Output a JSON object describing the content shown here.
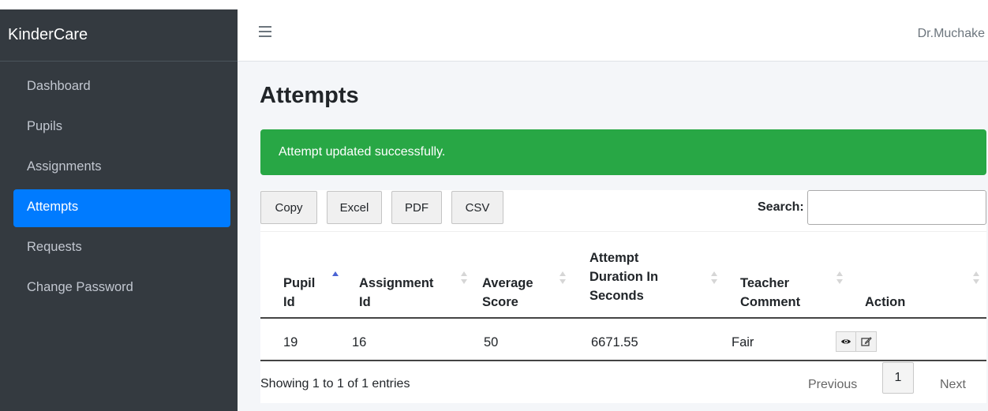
{
  "app": {
    "brand": "KinderCare"
  },
  "sidebar": {
    "items": [
      {
        "label": "Dashboard"
      },
      {
        "label": "Pupils"
      },
      {
        "label": "Assignments"
      },
      {
        "label": "Attempts"
      },
      {
        "label": "Requests"
      },
      {
        "label": "Change Password"
      }
    ],
    "active": "Attempts"
  },
  "header": {
    "user": "Dr.Muchake",
    "menu_icon": "hamburger-menu-icon"
  },
  "page": {
    "title": "Attempts"
  },
  "alert": {
    "message": "Attempt updated successfully.",
    "color": "#28a745"
  },
  "toolbar": {
    "buttons": [
      {
        "label": "Copy"
      },
      {
        "label": "Excel"
      },
      {
        "label": "PDF"
      },
      {
        "label": "CSV"
      }
    ],
    "search_label": "Search:",
    "search_value": ""
  },
  "table": {
    "columns": [
      {
        "line1": "Pupil",
        "line2": "Id"
      },
      {
        "line1": "Assignment",
        "line2": "Id"
      },
      {
        "line1": "Average",
        "line2": "Score"
      },
      {
        "line1": "Attempt",
        "line2": "Duration In",
        "line3": "Seconds"
      },
      {
        "line1": "Teacher",
        "line2": "Comment"
      },
      {
        "line1": "Action"
      }
    ],
    "sorted_column": "Pupil Id",
    "sort_direction": "ascending",
    "rows": [
      {
        "pupil_id": "19",
        "assignment_id": "16",
        "average_score": "50",
        "duration": "6671.55",
        "comment": "Fair",
        "actions": [
          "eye-icon",
          "edit-icon"
        ]
      }
    ]
  },
  "footer": {
    "info": "Showing 1 to 1 of 1 entries",
    "previous": "Previous",
    "current_page": "1",
    "next": "Next"
  },
  "colors": {
    "sidebar": "#343a40",
    "active_item": "#007bff",
    "success": "#28a745",
    "content_bg": "#f4f6f9"
  }
}
